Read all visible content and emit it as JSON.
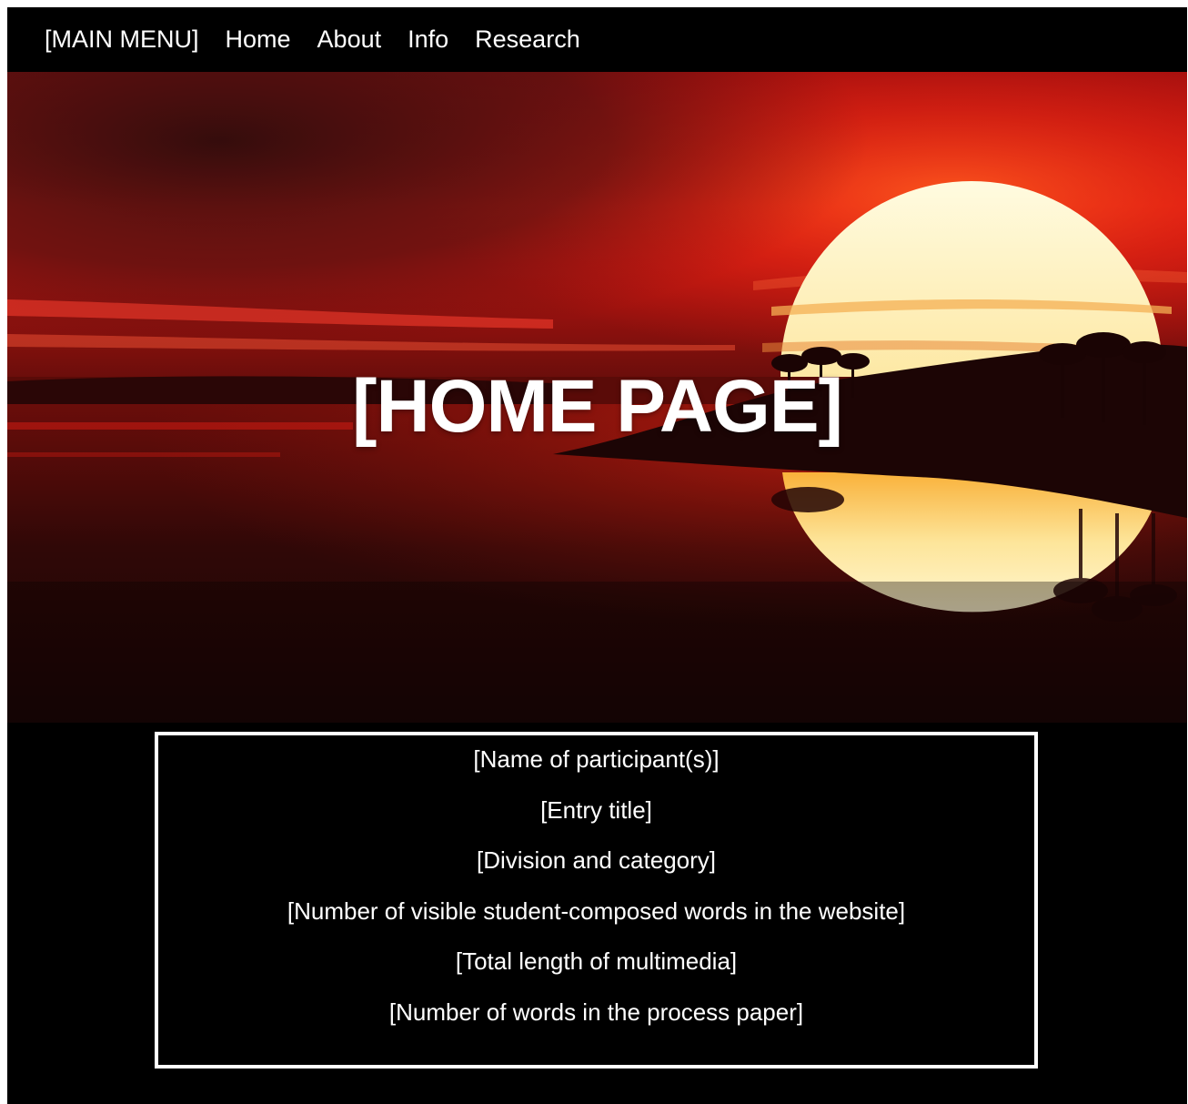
{
  "nav": {
    "items": [
      {
        "label": "[MAIN MENU]"
      },
      {
        "label": "Home"
      },
      {
        "label": "About"
      },
      {
        "label": "Info"
      },
      {
        "label": "Research"
      }
    ]
  },
  "hero": {
    "title": "[HOME PAGE]",
    "image": "sunset-over-water-with-palm-trees"
  },
  "info_box": {
    "lines": [
      "[Name of participant(s)]",
      "[Entry title]",
      "[Division and category]",
      "[Number of visible student-composed words in the website]",
      "[Total length of multimedia]",
      "[Number of words in the process paper]"
    ]
  },
  "colors": {
    "background": "#000000",
    "text": "#ffffff",
    "sky_red": "#e31a14",
    "sun": "#fbe9a0"
  }
}
